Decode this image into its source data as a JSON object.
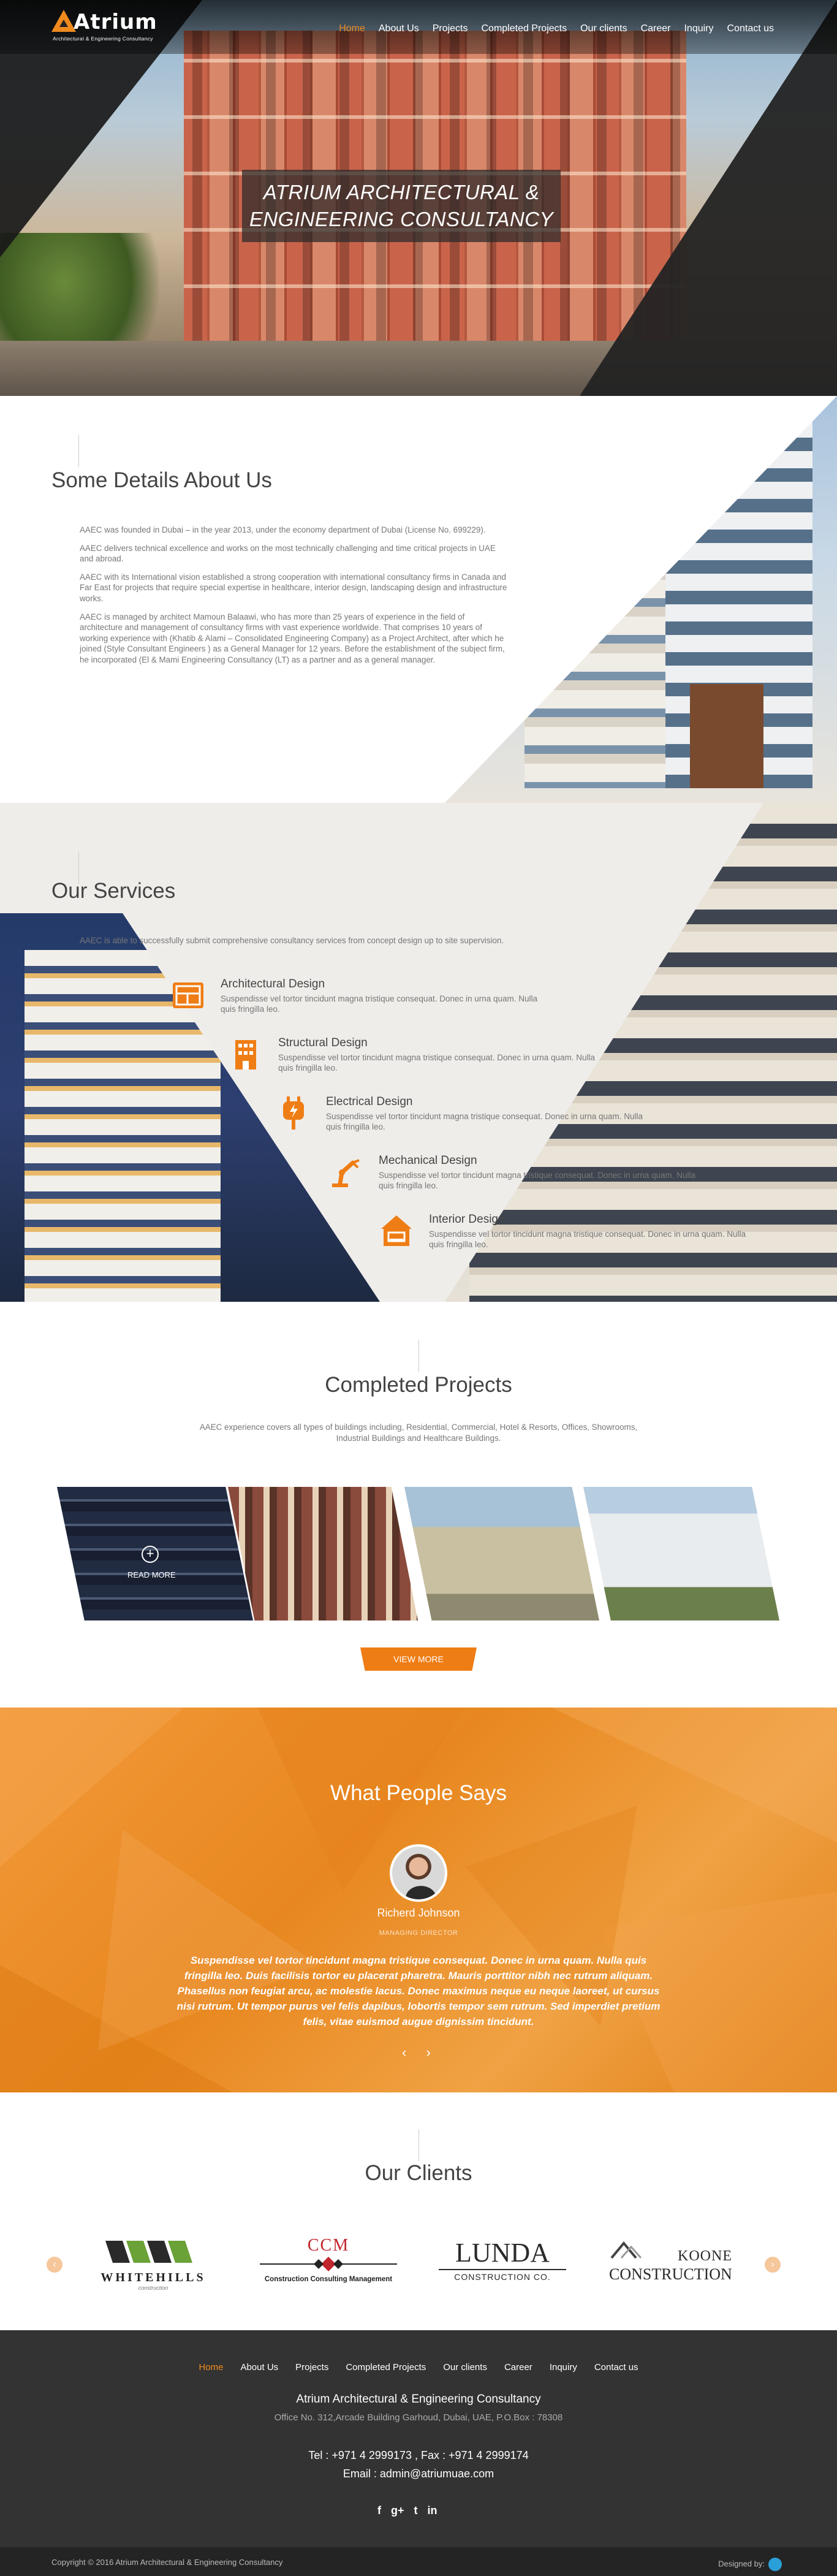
{
  "brand": {
    "name": "Atrium",
    "tagline": "Architectural & Engineering Consultancy"
  },
  "nav": [
    {
      "label": "Home",
      "active": true
    },
    {
      "label": "About Us"
    },
    {
      "label": "Projects"
    },
    {
      "label": "Completed Projects"
    },
    {
      "label": "Our clients"
    },
    {
      "label": "Career"
    },
    {
      "label": "Inquiry"
    },
    {
      "label": "Contact us"
    }
  ],
  "hero": {
    "title_line1": "ATRIUM ARCHITECTURAL &",
    "title_line2": "ENGINEERING CONSULTANCY"
  },
  "about": {
    "heading": "Some Details About Us",
    "paragraphs": [
      "AAEC  was founded in Dubai – in the year 2013, under the economy department of Dubai (License No. 699229).",
      "AAEC  delivers technical excellence and works on the most technically challenging and time critical projects in UAE and abroad.",
      "AAEC  with its International vision established a strong cooperation with international consultancy firms in Canada and Far East for projects that require special expertise in healthcare, interior design, landscaping design  and infrastructure works.",
      "AAEC  is managed by architect Mamoun Balaawi, who has more than 25 years of experience in the field of architecture and management of consultancy firms with vast experience worldwide. That comprises 10 years of working experience with (Khatib & Alami – Consolidated Engineering Company) as a Project Architect, after which he joined (Style Consultant Engineers ) as a General Manager for 12 years. Before the establishment of the subject firm, he incorporated (El & Mami Engineering Consultancy (LT) as a partner and as a general manager."
    ]
  },
  "services": {
    "heading": "Our Services",
    "intro": "AAEC  is able to successfully submit comprehensive consultancy services from concept design up to site supervision.",
    "items": [
      {
        "title": "Architectural Design",
        "desc": "Suspendisse vel tortor tincidunt magna tristique consequat. Donec in urna quam. Nulla quis fringilla leo.",
        "icon": "blueprint-icon"
      },
      {
        "title": "Structural Design",
        "desc": "Suspendisse vel tortor tincidunt magna tristique consequat. Donec in urna quam. Nulla quis fringilla leo.",
        "icon": "building-icon"
      },
      {
        "title": "Electrical Design",
        "desc": "Suspendisse vel tortor tincidunt magna tristique consequat. Donec in urna quam. Nulla quis fringilla leo.",
        "icon": "plug-icon"
      },
      {
        "title": "Mechanical Design",
        "desc": "Suspendisse vel tortor tincidunt magna tristique consequat. Donec in urna quam. Nulla quis fringilla leo.",
        "icon": "robot-arm-icon"
      },
      {
        "title": "Interior Design",
        "desc": "Suspendisse vel tortor tincidunt magna tristique consequat. Donec in urna quam. Nulla quis fringilla leo.",
        "icon": "interior-icon"
      }
    ]
  },
  "projects": {
    "heading": "Completed Projects",
    "intro": "AAEC experience covers all types of buildings including, Residential, Commercial, Hotel & Resorts, Offices, Showrooms, Industrial Buildings and Healthcare Buildings.",
    "read_more": "READ MORE",
    "view_more": "VIEW MORE"
  },
  "testimonial": {
    "heading": "What People Says",
    "name": "Richerd Johnson",
    "role": "MANAGING DIRECTOR",
    "quote": "Suspendisse vel tortor tincidunt magna tristique consequat. Donec in urna quam. Nulla quis fringilla leo. Duis facilisis tortor eu placerat pharetra. Mauris porttitor nibh nec rutrum aliquam. Phasellus non feugiat arcu, ac molestie lacus. Donec maximus neque eu neque laoreet, ut cursus nisi rutrum. Ut tempor purus vel felis dapibus, lobortis tempor sem rutrum. Sed imperdiet pretium felis, vitae euismod augue dignissim tincidunt.",
    "prev": "‹",
    "next": "›"
  },
  "clients": {
    "heading": "Our Clients",
    "logos": [
      {
        "name": "WHITEHILLS",
        "sub": "construction"
      },
      {
        "name": "CCM",
        "sub": "Construction Consulting Management"
      },
      {
        "name": "LUNDA",
        "sub": "CONSTRUCTION CO."
      },
      {
        "name": "KOONE",
        "sub": "CONSTRUCTION"
      }
    ]
  },
  "footer": {
    "company": "Atrium Architectural & Engineering Consultancy",
    "address": "Office No. 312,Arcade Building Garhoud, Dubai, UAE, P.O.Box : 78308",
    "phone": "Tel : +971 4 2999173 , Fax : +971 4 2999174",
    "email": "Email : admin@atriumuae.com",
    "social": [
      "f",
      "g+",
      "t",
      "in"
    ],
    "copyright": "Copyright © 2016 Atrium Architectural & Engineering Consultancy",
    "designed_by": "Designed by:"
  },
  "colors": {
    "accent": "#ef8a1f",
    "dark": "#333333"
  }
}
